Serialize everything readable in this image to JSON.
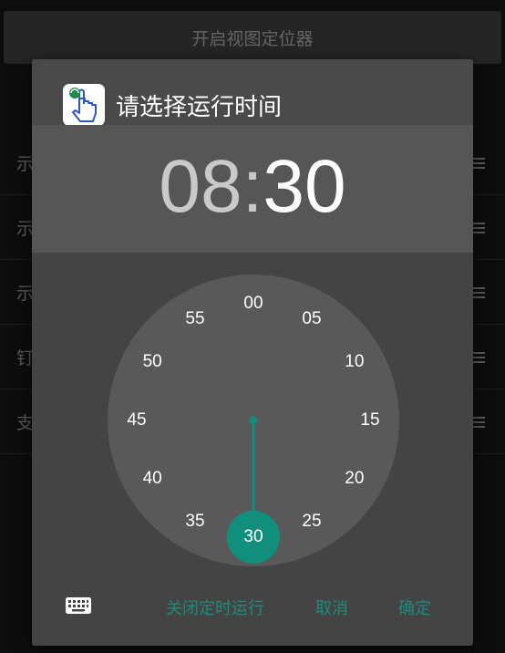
{
  "background": {
    "top_button": "开启视图定位器",
    "rows": [
      "示",
      "示",
      "示",
      "钉",
      "支"
    ]
  },
  "dialog": {
    "title": "请选择运行时间",
    "app_icon": "hand-tap-icon",
    "time": {
      "hour": "08",
      "separator": ":",
      "minute": "30"
    },
    "clock": {
      "ticks": [
        "00",
        "05",
        "10",
        "15",
        "20",
        "25",
        "30",
        "35",
        "40",
        "45",
        "50",
        "55"
      ],
      "selected": "30",
      "selected_index": 6
    },
    "actions": {
      "keyboard_icon": "keyboard-icon",
      "disable_label": "关闭定时运行",
      "cancel_label": "取消",
      "ok_label": "确定"
    }
  },
  "colors": {
    "accent": "#10907c",
    "dialog_bg": "#444444",
    "time_panel_bg": "#565656",
    "clock_face": "#595959",
    "action_text": "#1d8c7a"
  }
}
